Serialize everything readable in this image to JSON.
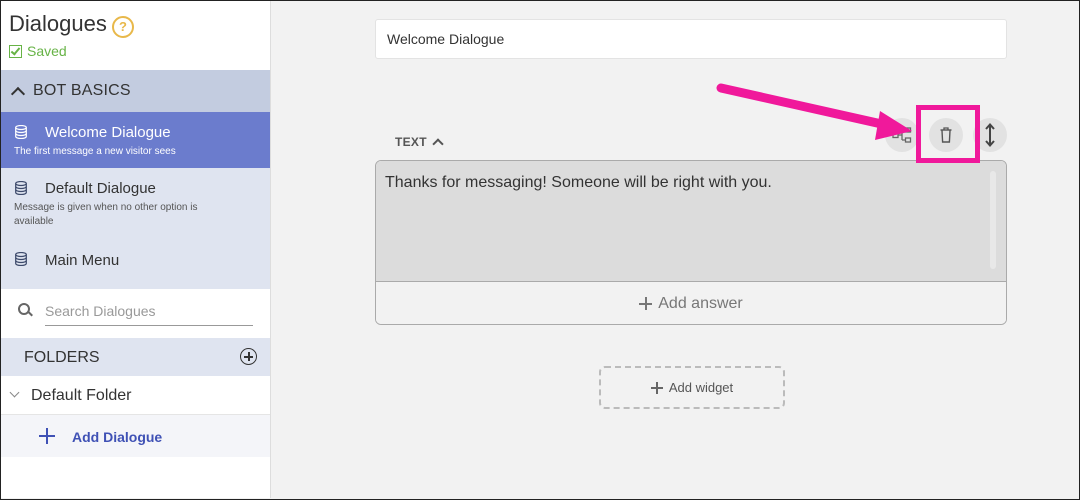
{
  "sidebar": {
    "title": "Dialogues",
    "saved_label": "Saved",
    "section_label": "BOT BASICS",
    "items": [
      {
        "name": "Welcome Dialogue",
        "subtitle": "The first message a new visitor sees",
        "active": true
      },
      {
        "name": "Default Dialogue",
        "subtitle": "Message is given when no other option is available",
        "active": false
      },
      {
        "name": "Main Menu",
        "subtitle": "",
        "active": false
      }
    ],
    "search_placeholder": "Search Dialogues",
    "folders_label": "FOLDERS",
    "folder_name": "Default Folder",
    "add_dialogue_label": "Add Dialogue"
  },
  "editor": {
    "dialogue_title": "Welcome Dialogue",
    "widget_type_label": "TEXT",
    "message_text": "Thanks for messaging! Someone will be right with you.",
    "add_answer_label": "Add answer",
    "add_widget_label": "Add widget"
  },
  "icons": {
    "help": "question-mark-icon",
    "saved": "checkbox-icon",
    "dialogue": "database-icon",
    "flow": "flow-chart-icon",
    "delete": "trash-icon",
    "reorder": "vertical-resize-icon"
  },
  "colors": {
    "active_item": "#6b7ccd",
    "section_bg": "#c3cce0",
    "item_bg": "#dfe4f0",
    "saved_green": "#67b346",
    "help_yellow": "#e8b84a",
    "link_blue": "#3f51b5",
    "annotation_pink": "#f0199b"
  }
}
